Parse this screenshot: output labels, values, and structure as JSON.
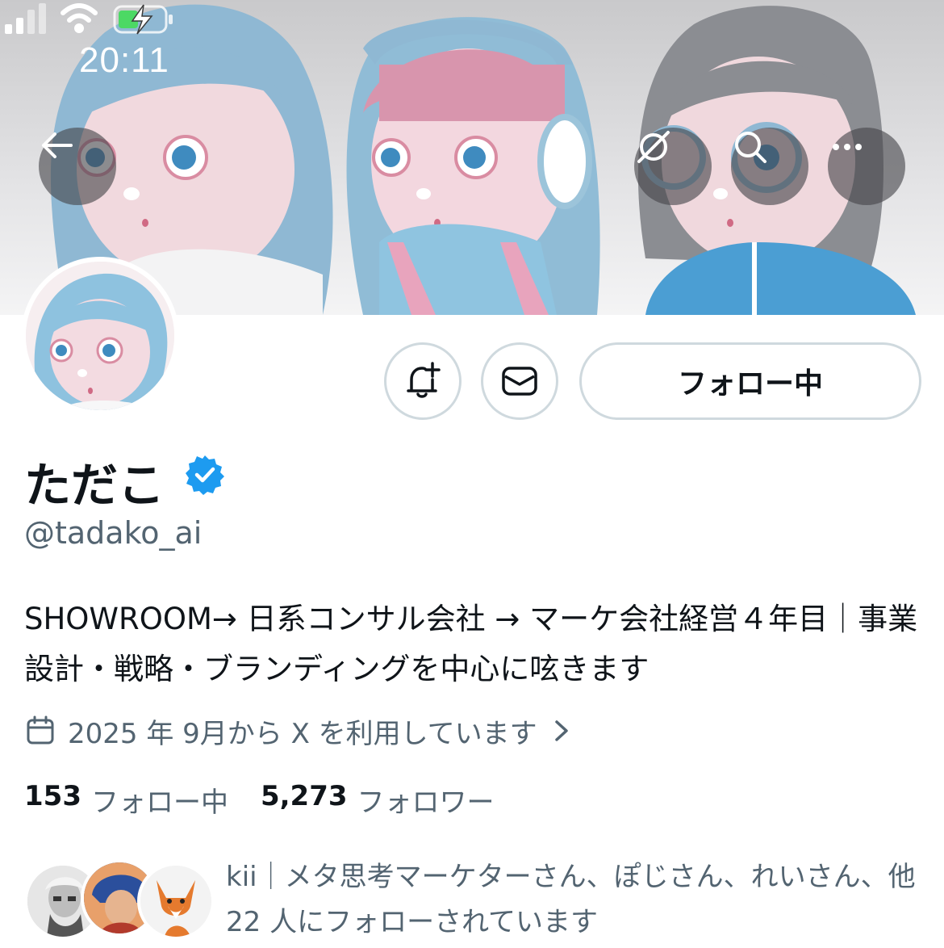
{
  "status_bar": {
    "time": "20:11"
  },
  "profile": {
    "display_name": "ただこ",
    "handle": "@tadako_ai",
    "bio": "SHOWROOM→ 日系コンサル会社 → マーケ会社経営４年目｜事業設計・戦略・ブランディングを中心に呟きます",
    "joined": "2025 年 9月から X を利用しています",
    "verified": true
  },
  "actions": {
    "follow_label": "フォロー中"
  },
  "stats": {
    "following_count": "153",
    "following_label": "フォロー中",
    "followers_count": "5,273",
    "followers_label": "フォロワー"
  },
  "followers_you_know": "kii｜メタ思考マーケターさん、ぽじさん、れいさん、他 22 人にフォローされています",
  "colors": {
    "verified_blue": "#1d9bf0",
    "text_primary": "#0f1419",
    "text_secondary": "#536471",
    "border": "#cfd9de"
  },
  "icons": [
    "back-arrow-icon",
    "grok-icon",
    "search-icon",
    "more-icon",
    "bell-plus-icon",
    "mail-icon",
    "verified-badge-icon",
    "calendar-icon",
    "chevron-right-icon"
  ]
}
